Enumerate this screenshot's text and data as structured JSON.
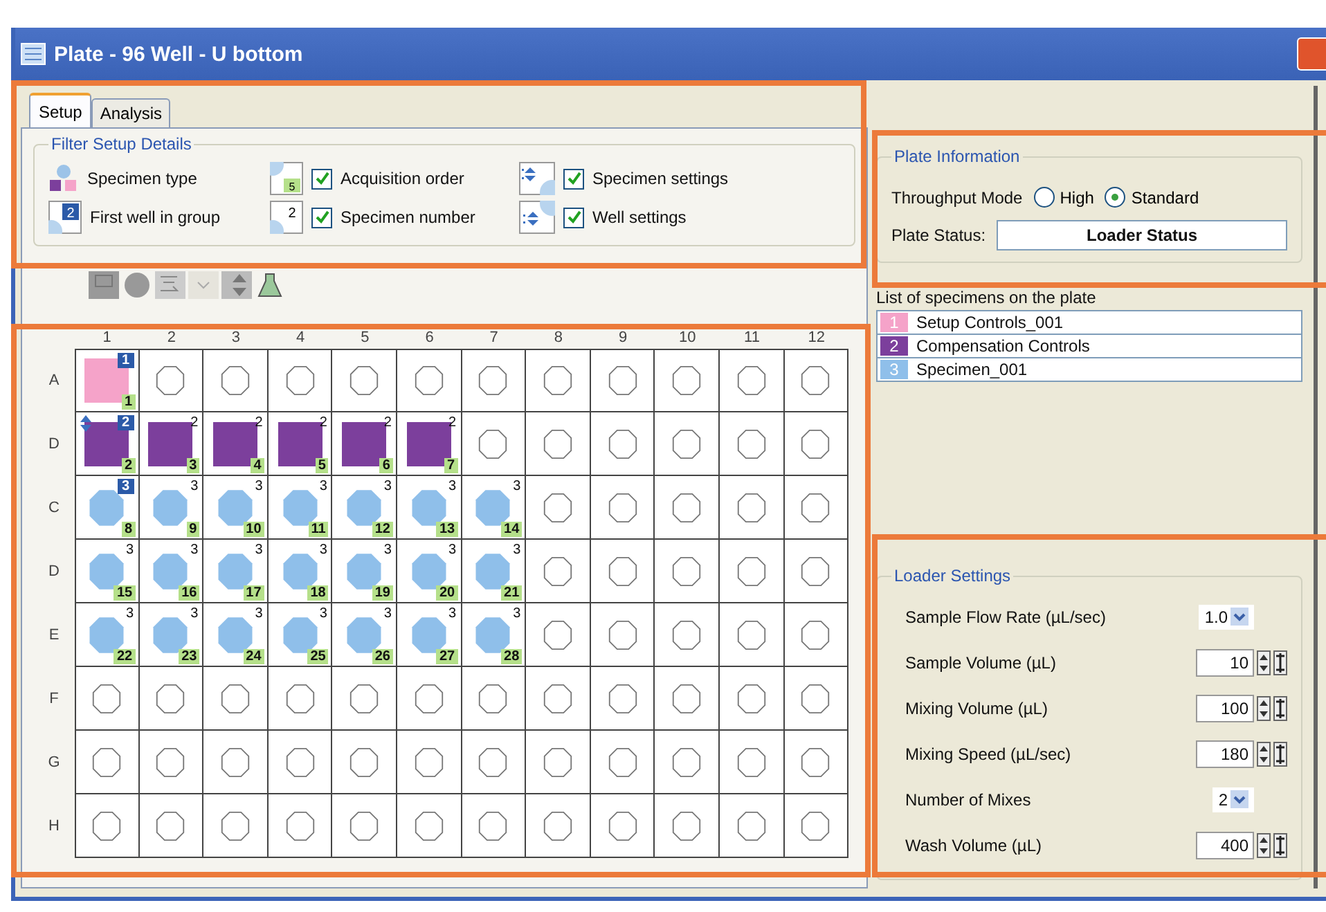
{
  "window": {
    "title": "Plate - 96 Well - U bottom"
  },
  "tabs": [
    {
      "label": "Setup",
      "selected": true
    },
    {
      "label": "Analysis",
      "selected": false
    }
  ],
  "filter": {
    "title": "Filter Setup Details",
    "items": [
      {
        "kind": "legend",
        "label": "Specimen type"
      },
      {
        "kind": "option",
        "label": "Acquisition order",
        "checked": true,
        "icon_label": "5"
      },
      {
        "kind": "option",
        "label": "Specimen settings",
        "checked": true
      },
      {
        "kind": "legend",
        "label": "First well in group",
        "icon_label": "2"
      },
      {
        "kind": "option",
        "label": "Specimen number",
        "checked": true,
        "icon_label": "2"
      },
      {
        "kind": "option",
        "label": "Well settings",
        "checked": true
      }
    ]
  },
  "plate": {
    "columns": [
      "1",
      "2",
      "3",
      "4",
      "5",
      "6",
      "7",
      "8",
      "9",
      "10",
      "11",
      "12"
    ],
    "rows": [
      {
        "label": "A",
        "wells": [
          {
            "kind": "square",
            "color": "#f5a3c9",
            "specimen": "1",
            "first": true,
            "order": "1"
          },
          {
            "kind": "empty"
          },
          {
            "kind": "empty"
          },
          {
            "kind": "empty"
          },
          {
            "kind": "empty"
          },
          {
            "kind": "empty"
          },
          {
            "kind": "empty"
          },
          {
            "kind": "empty"
          },
          {
            "kind": "empty"
          },
          {
            "kind": "empty"
          },
          {
            "kind": "empty"
          },
          {
            "kind": "empty"
          }
        ]
      },
      {
        "label": "D",
        "wells": [
          {
            "kind": "square",
            "color": "#7c3f9c",
            "specimen": "2",
            "first": true,
            "order": "2",
            "settings": true
          },
          {
            "kind": "square",
            "color": "#7c3f9c",
            "specimen": "2",
            "first": false,
            "order": "3"
          },
          {
            "kind": "square",
            "color": "#7c3f9c",
            "specimen": "2",
            "first": false,
            "order": "4"
          },
          {
            "kind": "square",
            "color": "#7c3f9c",
            "specimen": "2",
            "first": false,
            "order": "5"
          },
          {
            "kind": "square",
            "color": "#7c3f9c",
            "specimen": "2",
            "first": false,
            "order": "6"
          },
          {
            "kind": "square",
            "color": "#7c3f9c",
            "specimen": "2",
            "first": false,
            "order": "7"
          },
          {
            "kind": "empty"
          },
          {
            "kind": "empty"
          },
          {
            "kind": "empty"
          },
          {
            "kind": "empty"
          },
          {
            "kind": "empty"
          },
          {
            "kind": "empty"
          }
        ]
      },
      {
        "label": "C",
        "wells": [
          {
            "kind": "circle",
            "color": "#8fbfea",
            "specimen": "3",
            "first": true,
            "order": "8"
          },
          {
            "kind": "circle",
            "color": "#8fbfea",
            "specimen": "3",
            "first": false,
            "order": "9"
          },
          {
            "kind": "circle",
            "color": "#8fbfea",
            "specimen": "3",
            "first": false,
            "order": "10"
          },
          {
            "kind": "circle",
            "color": "#8fbfea",
            "specimen": "3",
            "first": false,
            "order": "11"
          },
          {
            "kind": "circle",
            "color": "#8fbfea",
            "specimen": "3",
            "first": false,
            "order": "12"
          },
          {
            "kind": "circle",
            "color": "#8fbfea",
            "specimen": "3",
            "first": false,
            "order": "13"
          },
          {
            "kind": "circle",
            "color": "#8fbfea",
            "specimen": "3",
            "first": false,
            "order": "14"
          },
          {
            "kind": "empty"
          },
          {
            "kind": "empty"
          },
          {
            "kind": "empty"
          },
          {
            "kind": "empty"
          },
          {
            "kind": "empty"
          }
        ]
      },
      {
        "label": "D",
        "wells": [
          {
            "kind": "circle",
            "color": "#8fbfea",
            "specimen": "3",
            "first": false,
            "order": "15"
          },
          {
            "kind": "circle",
            "color": "#8fbfea",
            "specimen": "3",
            "first": false,
            "order": "16"
          },
          {
            "kind": "circle",
            "color": "#8fbfea",
            "specimen": "3",
            "first": false,
            "order": "17"
          },
          {
            "kind": "circle",
            "color": "#8fbfea",
            "specimen": "3",
            "first": false,
            "order": "18"
          },
          {
            "kind": "circle",
            "color": "#8fbfea",
            "specimen": "3",
            "first": false,
            "order": "19"
          },
          {
            "kind": "circle",
            "color": "#8fbfea",
            "specimen": "3",
            "first": false,
            "order": "20"
          },
          {
            "kind": "circle",
            "color": "#8fbfea",
            "specimen": "3",
            "first": false,
            "order": "21"
          },
          {
            "kind": "empty"
          },
          {
            "kind": "empty"
          },
          {
            "kind": "empty"
          },
          {
            "kind": "empty"
          },
          {
            "kind": "empty"
          }
        ]
      },
      {
        "label": "E",
        "wells": [
          {
            "kind": "circle",
            "color": "#8fbfea",
            "specimen": "3",
            "first": false,
            "order": "22"
          },
          {
            "kind": "circle",
            "color": "#8fbfea",
            "specimen": "3",
            "first": false,
            "order": "23"
          },
          {
            "kind": "circle",
            "color": "#8fbfea",
            "specimen": "3",
            "first": false,
            "order": "24"
          },
          {
            "kind": "circle",
            "color": "#8fbfea",
            "specimen": "3",
            "first": false,
            "order": "25"
          },
          {
            "kind": "circle",
            "color": "#8fbfea",
            "specimen": "3",
            "first": false,
            "order": "26"
          },
          {
            "kind": "circle",
            "color": "#8fbfea",
            "specimen": "3",
            "first": false,
            "order": "27"
          },
          {
            "kind": "circle",
            "color": "#8fbfea",
            "specimen": "3",
            "first": false,
            "order": "28"
          },
          {
            "kind": "empty"
          },
          {
            "kind": "empty"
          },
          {
            "kind": "empty"
          },
          {
            "kind": "empty"
          },
          {
            "kind": "empty"
          }
        ]
      },
      {
        "label": "F",
        "wells": [
          {
            "kind": "empty"
          },
          {
            "kind": "empty"
          },
          {
            "kind": "empty"
          },
          {
            "kind": "empty"
          },
          {
            "kind": "empty"
          },
          {
            "kind": "empty"
          },
          {
            "kind": "empty"
          },
          {
            "kind": "empty"
          },
          {
            "kind": "empty"
          },
          {
            "kind": "empty"
          },
          {
            "kind": "empty"
          },
          {
            "kind": "empty"
          }
        ]
      },
      {
        "label": "G",
        "wells": [
          {
            "kind": "empty"
          },
          {
            "kind": "empty"
          },
          {
            "kind": "empty"
          },
          {
            "kind": "empty"
          },
          {
            "kind": "empty"
          },
          {
            "kind": "empty"
          },
          {
            "kind": "empty"
          },
          {
            "kind": "empty"
          },
          {
            "kind": "empty"
          },
          {
            "kind": "empty"
          },
          {
            "kind": "empty"
          },
          {
            "kind": "empty"
          }
        ]
      },
      {
        "label": "H",
        "wells": [
          {
            "kind": "empty"
          },
          {
            "kind": "empty"
          },
          {
            "kind": "empty"
          },
          {
            "kind": "empty"
          },
          {
            "kind": "empty"
          },
          {
            "kind": "empty"
          },
          {
            "kind": "empty"
          },
          {
            "kind": "empty"
          },
          {
            "kind": "empty"
          },
          {
            "kind": "empty"
          },
          {
            "kind": "empty"
          },
          {
            "kind": "empty"
          }
        ]
      }
    ]
  },
  "plate_information": {
    "title": "Plate Information",
    "throughput_label": "Throughput Mode",
    "throughput_options": [
      {
        "label": "High",
        "selected": false
      },
      {
        "label": "Standard",
        "selected": true
      }
    ],
    "status_label": "Plate Status:",
    "status_value": "Loader Status"
  },
  "specimen_list": {
    "title": "List of specimens on the plate",
    "items": [
      {
        "number": "1",
        "name": "Setup Controls_001",
        "color": "#f5a3c9"
      },
      {
        "number": "2",
        "name": "Compensation Controls",
        "color": "#7c3f9c"
      },
      {
        "number": "3",
        "name": "Specimen_001",
        "color": "#8fbfea"
      }
    ]
  },
  "loader_settings": {
    "title": "Loader Settings",
    "rows": [
      {
        "kind": "dropdown",
        "label": "Sample Flow Rate (µL/sec)",
        "value": "1.0"
      },
      {
        "kind": "spinner",
        "label": "Sample Volume (µL)",
        "value": "10"
      },
      {
        "kind": "spinner",
        "label": "Mixing Volume (µL)",
        "value": "100"
      },
      {
        "kind": "spinner",
        "label": "Mixing Speed (µL/sec)",
        "value": "180"
      },
      {
        "kind": "dropdown",
        "label": "Number of Mixes",
        "value": "2"
      },
      {
        "kind": "spinner",
        "label": "Wash Volume (µL)",
        "value": "400"
      }
    ]
  }
}
